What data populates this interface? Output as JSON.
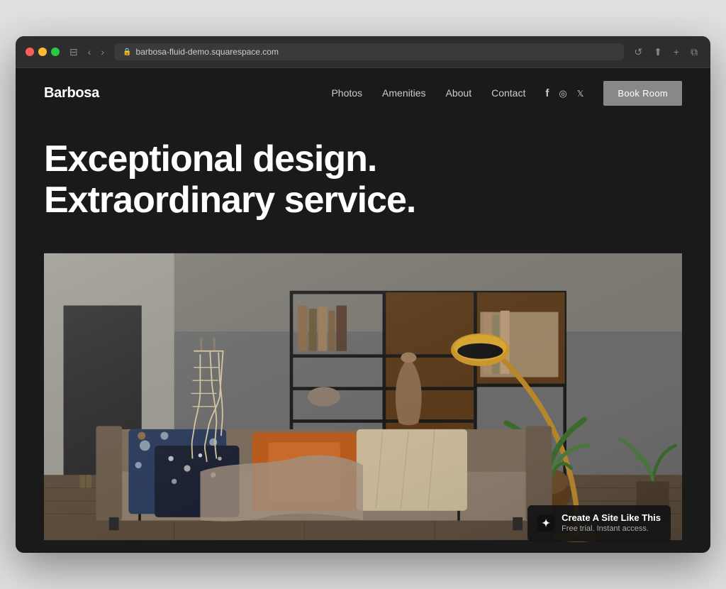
{
  "browser": {
    "url": "barbosa-fluid-demo.squarespace.com",
    "back_btn": "‹",
    "forward_btn": "›",
    "refresh_btn": "↺",
    "share_btn": "⬆",
    "add_tab_btn": "+",
    "duplicate_btn": "⧉",
    "tab_btn": "⊟"
  },
  "header": {
    "logo": "Barbosa",
    "nav": {
      "photos": "Photos",
      "amenities": "Amenities",
      "about": "About",
      "contact": "Contact"
    },
    "book_room_btn": "Book Room"
  },
  "hero": {
    "headline_line1": "Exceptional design.",
    "headline_line2": "Extraordinary service."
  },
  "squarespace_badge": {
    "title": "Create A Site Like This",
    "subtitle": "Free trial. Instant access."
  },
  "colors": {
    "background": "#1a1a1a",
    "text_primary": "#ffffff",
    "text_secondary": "#cccccc",
    "nav_bg": "#2d2d2d",
    "book_btn_bg": "#888888",
    "badge_bg": "rgba(20,20,20,0.92)"
  }
}
